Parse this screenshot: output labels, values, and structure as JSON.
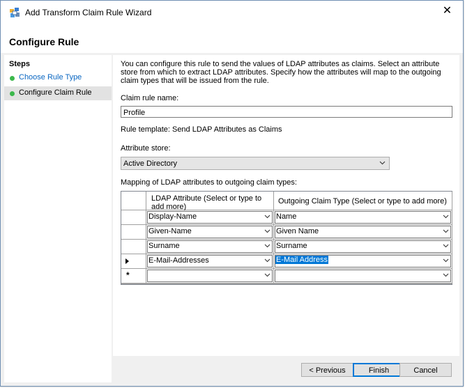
{
  "window": {
    "title": "Add Transform Claim Rule Wizard",
    "close_glyph": "✕"
  },
  "header": {
    "title": "Configure Rule"
  },
  "steps": {
    "heading": "Steps",
    "items": [
      {
        "label": "Choose Rule Type",
        "state": "link"
      },
      {
        "label": "Configure Claim Rule",
        "state": "current"
      }
    ]
  },
  "main": {
    "description": "You can configure this rule to send the values of LDAP attributes as claims. Select an attribute store from which to extract LDAP attributes. Specify how the attributes will map to the outgoing claim types that will be issued from the rule.",
    "claim_rule_name_label": "Claim rule name:",
    "claim_rule_name_value": "Profile",
    "rule_template_text": "Rule template: Send LDAP Attributes as Claims",
    "attribute_store_label": "Attribute store:",
    "attribute_store_value": "Active Directory",
    "mapping_label": "Mapping of LDAP attributes to outgoing claim types:",
    "grid": {
      "col_ldap": "LDAP Attribute (Select or type to add more)",
      "col_claim": "Outgoing Claim Type (Select or type to add more)",
      "rows": [
        {
          "ldap": "Display-Name",
          "claim": "Name"
        },
        {
          "ldap": "Given-Name",
          "claim": "Given Name"
        },
        {
          "ldap": "Surname",
          "claim": "Surname"
        },
        {
          "ldap": "E-Mail-Addresses",
          "claim": "E-Mail Address"
        },
        {
          "ldap": "",
          "claim": ""
        }
      ],
      "new_row_marker": "*"
    }
  },
  "footer": {
    "previous_label": "< Previous",
    "finish_label": "Finish",
    "cancel_label": "Cancel"
  },
  "colors": {
    "accent": "#0078d7",
    "step_dot": "#3cb84c",
    "link": "#0b67c2"
  },
  "icons": {
    "title": "wizard-app-icon",
    "close": "close-icon",
    "dropdown": "chevron-down-icon",
    "current_row": "row-pointer-icon"
  }
}
